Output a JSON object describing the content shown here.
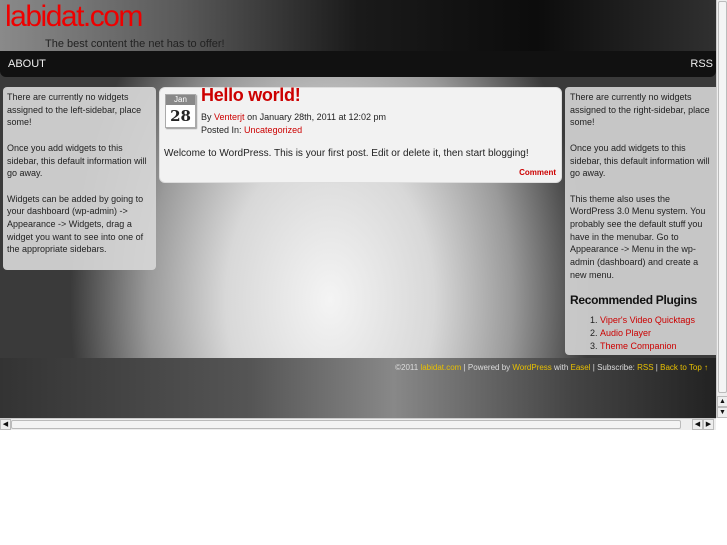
{
  "site": {
    "title": "labidat.com",
    "tagline": "The best content the net has to offer!"
  },
  "nav": {
    "about": "ABOUT",
    "rss": "RSS"
  },
  "left_sidebar": {
    "paragraphs": [
      "There are currently no widgets assigned to the left-sidebar, place some!",
      "Once you add widgets to this sidebar, this default information will go away.",
      "Widgets can be added by going to your dashboard (wp-admin) -> Appearance -> Widgets, drag a widget you want to see into one of the appropriate sidebars."
    ]
  },
  "post": {
    "month": "Jan",
    "day": "28",
    "title": "Hello world!",
    "by": "By",
    "author": "Venterjt",
    "date": "on January 28th, 2011 at 12:02 pm",
    "posted_in": "Posted In:",
    "category": "Uncategorized",
    "body": "Welcome to WordPress. This is your first post. Edit or delete it, then start blogging!",
    "comment": "Comment"
  },
  "right_sidebar": {
    "paragraphs": [
      "There are currently no widgets assigned to the right-sidebar, place some!",
      "Once you add widgets to this sidebar, this default information will go away.",
      "This theme also uses the WordPress 3.0 Menu system. You probably see the default stuff you have in the menubar. Go to Appearance -> Menu in the wp-admin (dashboard) and create a new menu."
    ],
    "plugins_title": "Recommended Plugins",
    "plugins": [
      "Viper's Video Quicktags",
      "Audio Player",
      "Theme Companion"
    ]
  },
  "footer": {
    "copyright": "©2011",
    "site": "labidat.com",
    "sep": "|",
    "powered": "Powered by",
    "wordpress": "WordPress",
    "with": "with",
    "easel": "Easel",
    "subscribe": "Subscribe:",
    "rss": "RSS",
    "back_to_top": "Back to Top ↑"
  }
}
